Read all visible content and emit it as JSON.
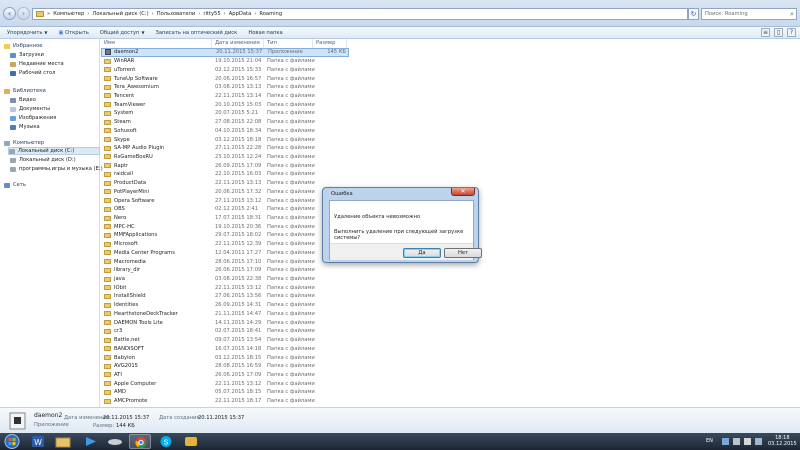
{
  "address": {
    "crumbs": [
      "Компьютер",
      "Локальный диск (C:)",
      "Пользователи",
      "ritty55",
      "AppData",
      "Roaming"
    ],
    "search_placeholder": "Поиск: Roaming"
  },
  "toolbar": {
    "organize": "Упорядочить",
    "open": "Открыть",
    "share": "Общий доступ",
    "burn": "Записать на оптический диск",
    "new_folder": "Новая папка"
  },
  "nav": {
    "favorites": "Избранное",
    "downloads": "Загрузки",
    "recent": "Недавние места",
    "desktop": "Рабочий стол",
    "libraries": "Библиотеки",
    "video": "Видео",
    "documents": "Документы",
    "images": "Изображения",
    "music": "Музыка",
    "computer": "Компьютер",
    "disk_c": "Локальный диск (C:)",
    "disk_d": "Локальный диск (D:)",
    "disk_e": "программы,игры и музыка (E:)",
    "network": "Сеть"
  },
  "columns": {
    "name": "Имя",
    "date": "Дата изменения",
    "type": "Тип",
    "size": "Размер"
  },
  "files": [
    {
      "name": "daemon2",
      "date": "20.11.2015 15:37",
      "type": "Приложение",
      "size": "145 КБ"
    },
    {
      "name": "WinRAR",
      "date": "19.10.2015 21:04",
      "type": "Папка с файлами",
      "size": ""
    },
    {
      "name": "uTorrent",
      "date": "02.12.2015 15:33",
      "type": "Папка с файлами",
      "size": ""
    },
    {
      "name": "TuneUp Software",
      "date": "20.06.2015 16:57",
      "type": "Папка с файлами",
      "size": ""
    },
    {
      "name": "Tera_Awesomium",
      "date": "03.08.2015 13:13",
      "type": "Папка с файлами",
      "size": ""
    },
    {
      "name": "Tencent",
      "date": "22.11.2015 13:14",
      "type": "Папка с файлами",
      "size": ""
    },
    {
      "name": "TeamViewer",
      "date": "20.10.2015 15:03",
      "type": "Папка с файлами",
      "size": ""
    },
    {
      "name": "System",
      "date": "20.07.2015 5:21",
      "type": "Папка с файлами",
      "size": ""
    },
    {
      "name": "Steam",
      "date": "27.08.2015 22:08",
      "type": "Папка с файлами",
      "size": ""
    },
    {
      "name": "Sohusoft",
      "date": "04.10.2015 18:34",
      "type": "Папка с файлами",
      "size": ""
    },
    {
      "name": "Skype",
      "date": "03.12.2015 18:18",
      "type": "Папка с файлами",
      "size": ""
    },
    {
      "name": "SA-MP Audio Plugin",
      "date": "27.11.2015 22:28",
      "type": "Папка с файлами",
      "size": ""
    },
    {
      "name": "RsGameBoxRU",
      "date": "23.10.2015 12:24",
      "type": "Папка с файлами",
      "size": ""
    },
    {
      "name": "Raptr",
      "date": "26.09.2015 17:09",
      "type": "Папка с файлами",
      "size": ""
    },
    {
      "name": "raidcall",
      "date": "22.10.2015 16:03",
      "type": "Папка с файлами",
      "size": ""
    },
    {
      "name": "ProductData",
      "date": "22.11.2015 13:13",
      "type": "Папка с файлами",
      "size": ""
    },
    {
      "name": "PotPlayerMini",
      "date": "20.06.2015 17:32",
      "type": "Папка с файлами",
      "size": ""
    },
    {
      "name": "Opera Software",
      "date": "27.11.2015 13:12",
      "type": "Папка с файлами",
      "size": ""
    },
    {
      "name": "OBS",
      "date": "02.12.2015 2:41",
      "type": "Папка с файлами",
      "size": ""
    },
    {
      "name": "Nero",
      "date": "17.07.2015 18:31",
      "type": "Папка с файлами",
      "size": ""
    },
    {
      "name": "MPC-HC",
      "date": "19.10.2015 20:36",
      "type": "Папка с файлами",
      "size": ""
    },
    {
      "name": "MMFApplications",
      "date": "29.07.2015 18:02",
      "type": "Папка с файлами",
      "size": ""
    },
    {
      "name": "Microsoft",
      "date": "22.11.2015 12:39",
      "type": "Папка с файлами",
      "size": ""
    },
    {
      "name": "Media Center Programs",
      "date": "12.04.2011 17:27",
      "type": "Папка с файлами",
      "size": ""
    },
    {
      "name": "Macromedia",
      "date": "28.06.2015 17:10",
      "type": "Папка с файлами",
      "size": ""
    },
    {
      "name": "library_dir",
      "date": "26.06.2015 17:09",
      "type": "Папка с файлами",
      "size": ""
    },
    {
      "name": "java",
      "date": "03.08.2015 22:38",
      "type": "Папка с файлами",
      "size": ""
    },
    {
      "name": "IObit",
      "date": "22.11.2015 13:12",
      "type": "Папка с файлами",
      "size": ""
    },
    {
      "name": "InstallShield",
      "date": "27.06.2015 13:56",
      "type": "Папка с файлами",
      "size": ""
    },
    {
      "name": "Identities",
      "date": "26.09.2015 14:31",
      "type": "Папка с файлами",
      "size": ""
    },
    {
      "name": "HearthstoneDeckTracker",
      "date": "21.11.2015 14:47",
      "type": "Папка с файлами",
      "size": ""
    },
    {
      "name": "DAEMON Tools Lite",
      "date": "14.11.2015 14:29",
      "type": "Папка с файлами",
      "size": ""
    },
    {
      "name": "cr3",
      "date": "02.07.2015 18:41",
      "type": "Папка с файлами",
      "size": ""
    },
    {
      "name": "Battle.net",
      "date": "09.07.2015 13:54",
      "type": "Папка с файлами",
      "size": ""
    },
    {
      "name": "BANDISOFT",
      "date": "16.07.2015 14:18",
      "type": "Папка с файлами",
      "size": ""
    },
    {
      "name": "Babylon",
      "date": "03.12.2015 18:15",
      "type": "Папка с файлами",
      "size": ""
    },
    {
      "name": "AVG2015",
      "date": "28.08.2015 16:59",
      "type": "Папка с файлами",
      "size": ""
    },
    {
      "name": "ATI",
      "date": "26.06.2015 17:09",
      "type": "Папка с файлами",
      "size": ""
    },
    {
      "name": "Apple Computer",
      "date": "22.11.2015 13:12",
      "type": "Папка с файлами",
      "size": ""
    },
    {
      "name": "AMD",
      "date": "05.07.2015 18:15",
      "type": "Папка с файлами",
      "size": ""
    },
    {
      "name": "AMCPromote",
      "date": "22.11.2015 18:17",
      "type": "Папка с файлами",
      "size": ""
    }
  ],
  "details": {
    "name": "daemon2",
    "type": "Приложение",
    "modified_label": "Дата изменения:",
    "modified": "20.11.2015 15:37",
    "created_label": "Дата создания:",
    "created": "20.11.2015 15:37",
    "size_label": "Размер:",
    "size": "144 КБ"
  },
  "dialog": {
    "title": "Ошибка",
    "line1": "Удаление объекта невозможно",
    "line2": "Выполнить удаление при следующей загрузке системы?",
    "yes": "Да",
    "no": "Нет"
  },
  "tray": {
    "lang": "EN",
    "time": "18:18",
    "date": "03.12.2015"
  },
  "colors": {
    "selection": "#cce3f8",
    "folder": "#ecca70",
    "taskbar": "#1c2633",
    "dialog_frame": "#b9d1ea"
  }
}
